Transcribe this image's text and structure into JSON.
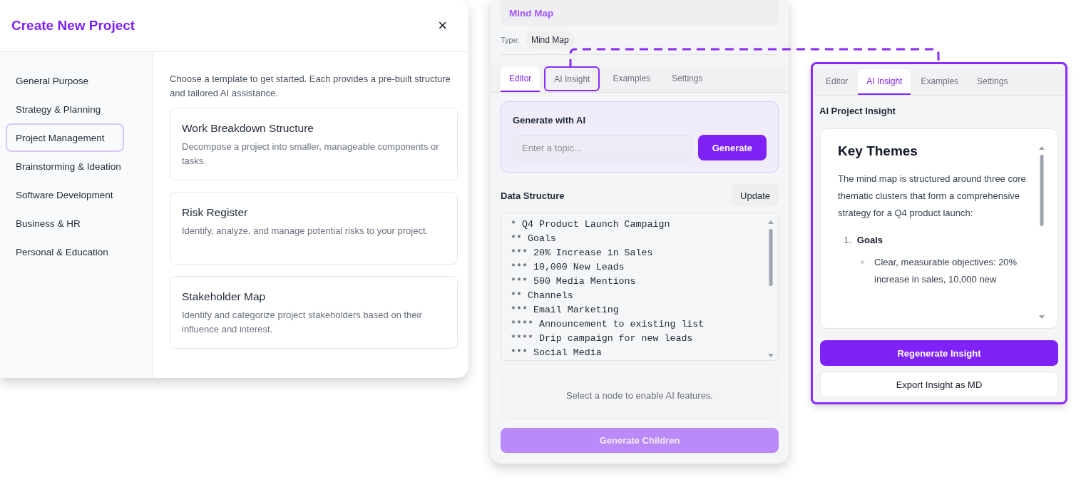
{
  "create_project_dialog": {
    "title": "Create New Project",
    "close": "×",
    "categories": [
      {
        "label": "General Purpose",
        "selected": false
      },
      {
        "label": "Strategy & Planning",
        "selected": false
      },
      {
        "label": "Project Management",
        "selected": true
      },
      {
        "label": "Brainstorming & Ideation",
        "selected": false
      },
      {
        "label": "Software Development",
        "selected": false
      },
      {
        "label": "Business & HR",
        "selected": false
      },
      {
        "label": "Personal & Education",
        "selected": false
      }
    ],
    "intro": "Choose a template to get started. Each provides a pre-built structure and tailored AI assistance.",
    "templates": [
      {
        "title": "Work Breakdown Structure",
        "description": "Decompose a project into smaller, manageable components or tasks."
      },
      {
        "title": "Risk Register",
        "description": "Identify, analyze, and manage potential risks to your project."
      },
      {
        "title": "Stakeholder Map",
        "description": "Identify and categorize project stakeholders based on their influence and interest."
      }
    ]
  },
  "editor_panel": {
    "name_field": {
      "value": "Mind Map"
    },
    "type_label": "Type:",
    "type_value": "Mind Map",
    "tabs": [
      {
        "label": "Editor",
        "selected": true,
        "highlighted": false
      },
      {
        "label": "AI Insight",
        "selected": false,
        "highlighted": true
      },
      {
        "label": "Examples",
        "selected": false,
        "highlighted": false
      },
      {
        "label": "Settings",
        "selected": false,
        "highlighted": false
      }
    ],
    "generate": {
      "title": "Generate with AI",
      "input": {
        "placeholder": "Enter a topic..."
      },
      "button": "Generate"
    },
    "data_structure": {
      "title": "Data Structure",
      "button": "Update",
      "lines": [
        "* Q4 Product Launch Campaign",
        "** Goals",
        "*** 20% Increase in Sales",
        "*** 10,000 New Leads",
        "*** 500 Media Mentions",
        "** Channels",
        "*** Email Marketing",
        "**** Announcement to existing list",
        "**** Drip campaign for new leads",
        "*** Social Media"
      ]
    },
    "node_hint": "Select a node to enable AI features.",
    "generate_children": {
      "label": "Generate Children",
      "disabled": true
    }
  },
  "insight_panel": {
    "tabs": [
      {
        "label": "Editor",
        "selected": false
      },
      {
        "label": "AI Insight",
        "selected": true
      },
      {
        "label": "Examples",
        "selected": false
      },
      {
        "label": "Settings",
        "selected": false
      }
    ],
    "title": "AI Project Insight",
    "content": {
      "heading": "Key Themes",
      "paragraph": "The mind map is structured around three core thematic clusters that form a comprehensive strategy for a Q4 product launch:",
      "list": [
        {
          "number": "1.",
          "title": "Goals",
          "bullets": [
            "Clear, measurable objectives: 20% increase in sales, 10,000 new"
          ]
        }
      ]
    },
    "buttons": [
      {
        "label": "Regenerate Insight",
        "kind": "primary"
      },
      {
        "label": "Export Insight as MD",
        "kind": "secondary"
      }
    ]
  }
}
